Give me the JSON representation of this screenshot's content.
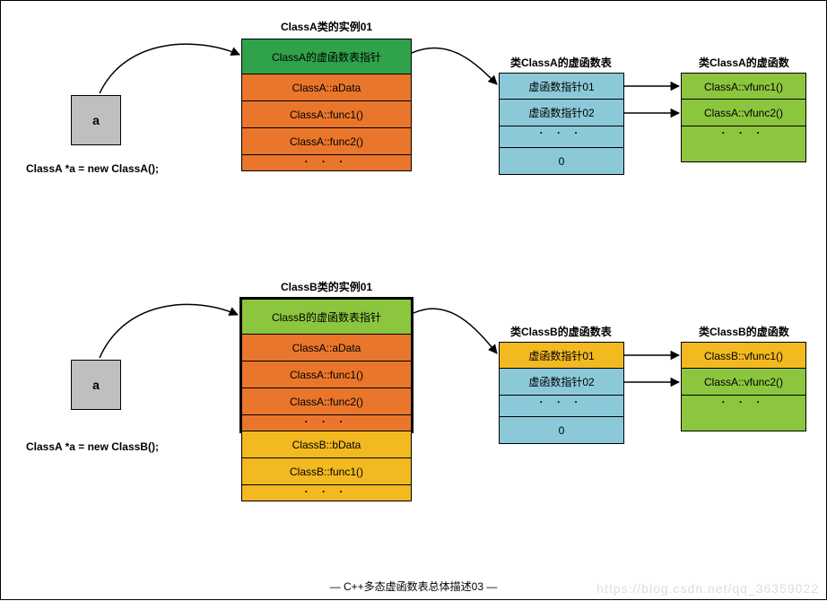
{
  "titles": {
    "instA": "ClassA类的实例01",
    "vtA": "类ClassA的虚函数表",
    "vfA": "类ClassA的虚函数",
    "instB": "ClassB类的实例01",
    "vtB": "类ClassB的虚函数表",
    "vfB": "类ClassB的虚函数"
  },
  "ptr": {
    "labelA": "a",
    "labelB": "a",
    "codeA": "ClassA *a = new ClassA();",
    "codeB": "ClassA *a = new ClassB();"
  },
  "instA": {
    "r0": "ClassA的虚函数表指针",
    "r1": "ClassA::aData",
    "r2": "ClassA::func1()",
    "r3": "ClassA::func2()",
    "dots": "·   ·   ·"
  },
  "vtA": {
    "r0": "虚函数指针01",
    "r1": "虚函数指针02",
    "dots": "·   ·   ·",
    "end": "0"
  },
  "vfA": {
    "r0": "ClassA::vfunc1()",
    "r1": "ClassA::vfunc2()",
    "dots": "·   ·   ·"
  },
  "instB": {
    "r0": "ClassB的虚函数表指针",
    "r1": "ClassA::aData",
    "r2": "ClassA::func1()",
    "r3": "ClassA::func2()",
    "dots1": "·   ·   ·",
    "r5": "ClassB::bData",
    "r6": "ClassB::func1()",
    "dots2": "·   ·   ·"
  },
  "vtB": {
    "r0": "虚函数指针01",
    "r1": "虚函数指针02",
    "dots": "·   ·   ·",
    "end": "0"
  },
  "vfB": {
    "r0": "ClassB::vfunc1()",
    "r1": "ClassA::vfunc2()",
    "dots": "·   ·   ·"
  },
  "footer": "—  C++多态虚函数表总体描述03  —",
  "watermark": "https://blog.csdn.net/qq_36359022"
}
